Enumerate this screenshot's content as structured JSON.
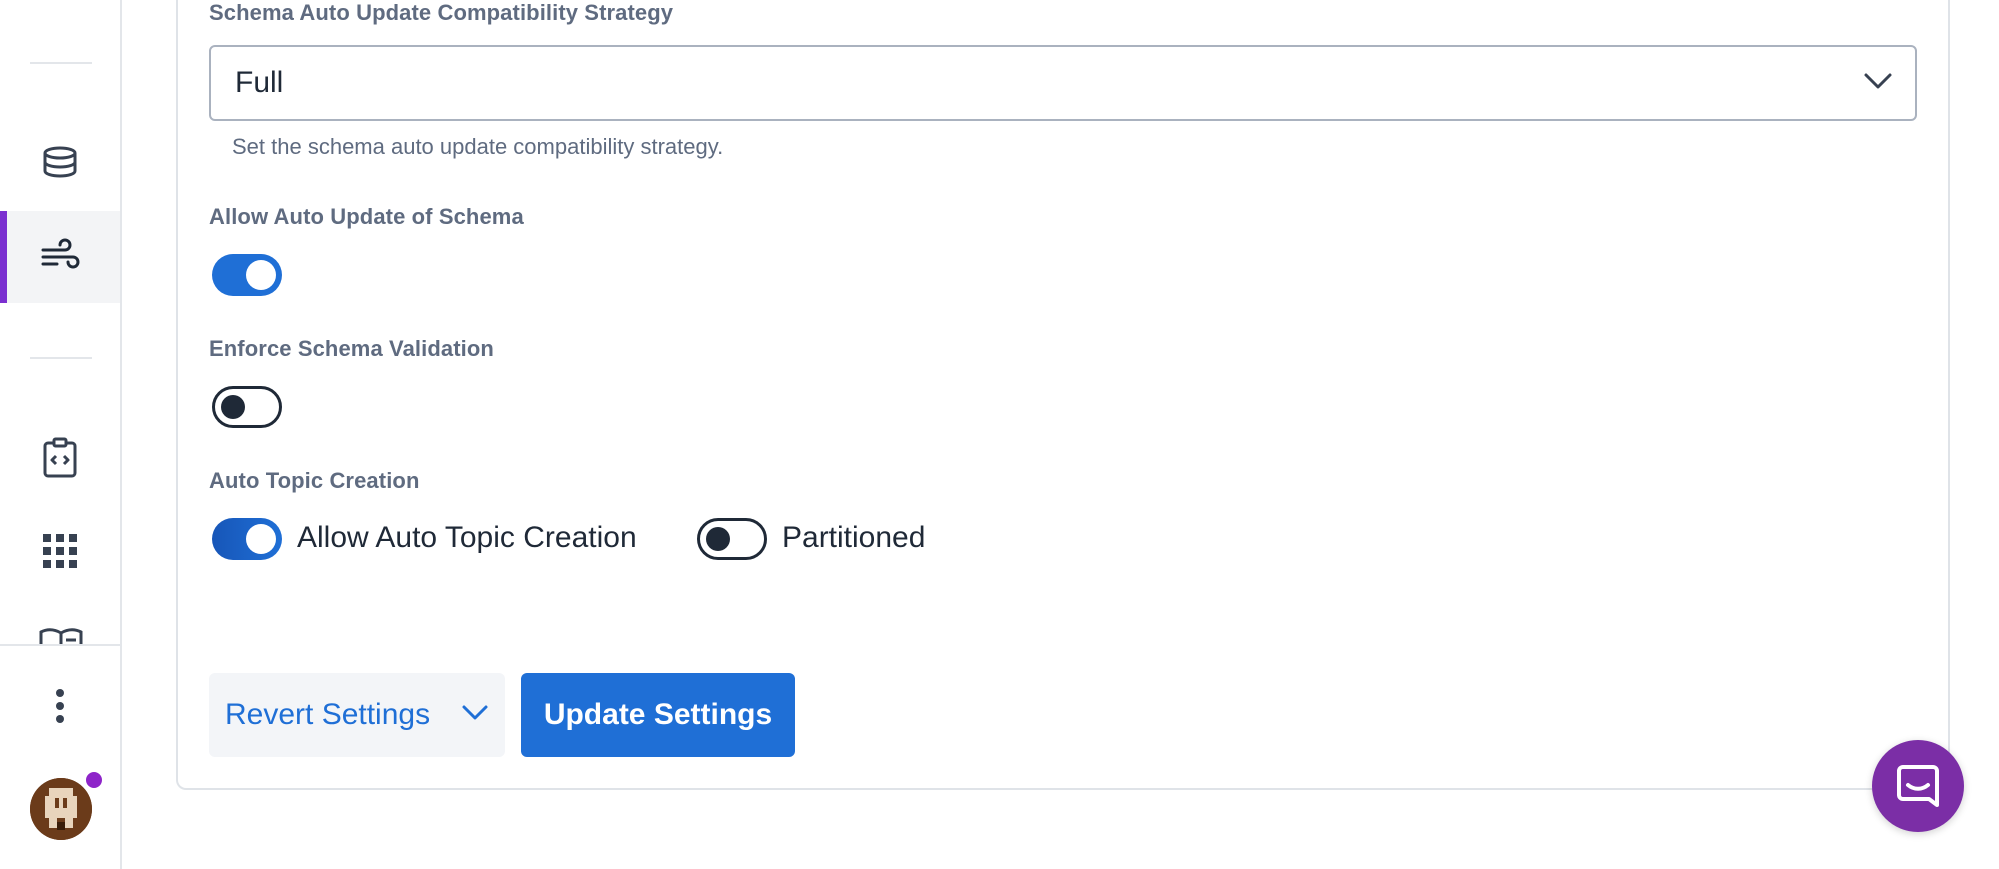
{
  "sidebar": {
    "icons": [
      "database-icon",
      "stream-icon",
      "code-clipboard-icon",
      "apps-grid-icon",
      "book-icon",
      "more-vertical-icon",
      "user-avatar"
    ],
    "active_item": "stream-icon",
    "accent_color": "#7b2fd0"
  },
  "settings": {
    "compat_strategy": {
      "label": "Schema Auto Update Compatibility Strategy",
      "value": "Full",
      "helper": "Set the schema auto update compatibility strategy."
    },
    "allow_auto_update": {
      "label": "Allow Auto Update of Schema",
      "enabled": true
    },
    "enforce_validation": {
      "label": "Enforce Schema Validation",
      "enabled": false
    },
    "auto_topic_creation": {
      "label": "Auto Topic Creation",
      "allow": {
        "label": "Allow Auto Topic Creation",
        "enabled": true
      },
      "partitioned": {
        "label": "Partitioned",
        "enabled": false
      }
    }
  },
  "actions": {
    "revert_label": "Revert Settings",
    "update_label": "Update Settings"
  },
  "colors": {
    "primary": "#1f6fd6",
    "chat": "#7b2ea6"
  }
}
